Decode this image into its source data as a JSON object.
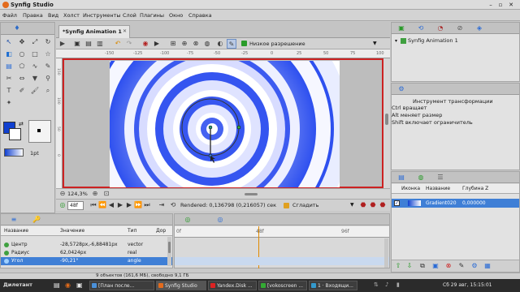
{
  "app": {
    "title": "Synfig Studio"
  },
  "menu": [
    "Файл",
    "Правка",
    "Вид",
    "Холст",
    "Инструменты",
    "Слой",
    "Плагины",
    "Окно",
    "Справка"
  ],
  "canvas_tab": {
    "title": "*Synfig Animation 1",
    "close": "✕"
  },
  "toolbar": {
    "resolution": "Низкое разрешение"
  },
  "ruler": {
    "top_ticks": [
      "-150",
      "-125",
      "-100",
      "-75",
      "-50",
      "-25",
      "0",
      "25",
      "50",
      "75",
      "100",
      "125",
      "150"
    ],
    "left_ticks": [
      "150",
      "100",
      "50",
      "0",
      "-50"
    ]
  },
  "status": {
    "zoom": "124,3%",
    "frame": "48f",
    "rendered": "Rendered: 0,136798 (0,216057) сек",
    "smooth": "Сгладить"
  },
  "toolbox": {
    "brush_size": "1pt"
  },
  "params": {
    "headers": {
      "name": "Название",
      "value": "Значение",
      "type": "Тип",
      "time": "Дор"
    },
    "rows": [
      {
        "name": "Центр",
        "value": "-28,5728px,-6,88481px",
        "type": "vector"
      },
      {
        "name": "Радиус",
        "value": "62,0424px",
        "type": "real"
      },
      {
        "name": "Угол",
        "value": "-90,21°",
        "type": "angle"
      }
    ]
  },
  "timeline": {
    "ticks": [
      "0f",
      "48f",
      "96f"
    ],
    "current": "48f"
  },
  "canvas_browser": {
    "item": "Synfig Animation 1"
  },
  "tool_options": {
    "title": "Инструмент трансформации",
    "lines": [
      "Ctrl вращает",
      "Alt меняет размер",
      "Shift включает ограничитель"
    ]
  },
  "layers": {
    "headers": {
      "icon": "Иконка",
      "name": "Название",
      "depth": "Глубина Z"
    },
    "rows": [
      {
        "name": "Gradient020",
        "depth": "0,000000"
      }
    ]
  },
  "statusbar": {
    "text": "9 объектов (161,6 МБ), свободно 9,1 ГБ"
  },
  "taskbar": {
    "start": "Дилетант",
    "items": [
      "[План после...",
      "Synfig Studio",
      "Yandex.Disk ...",
      "[vokoscreen ...",
      "1 · Входящи..."
    ],
    "clock": "Сб 29 авг, 15:15:01"
  },
  "colors": {
    "outline": "#1040d0",
    "fill": "#ffffff",
    "frame": "#cc2222",
    "selection": "#3f7fd6",
    "spiral_blue": "#2e50ef"
  }
}
